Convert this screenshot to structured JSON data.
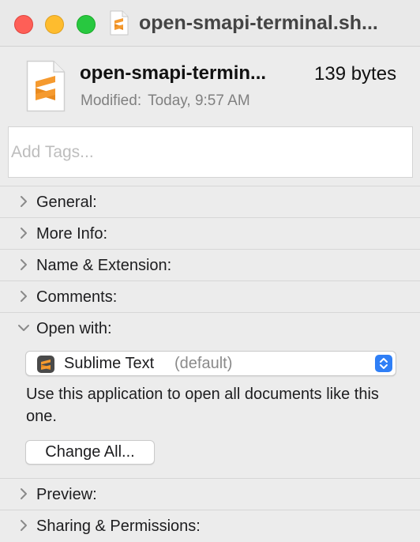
{
  "window": {
    "title": "open-smapi-terminal.sh..."
  },
  "file": {
    "name": "open-smapi-termin...",
    "size": "139 bytes",
    "modified_label": "Modified:",
    "modified_value": "Today, 9:57 AM",
    "icon": "sublime-file-icon"
  },
  "tags": {
    "placeholder": "Add Tags..."
  },
  "sections": {
    "general": "General:",
    "more_info": "More Info:",
    "name_extension": "Name & Extension:",
    "comments": "Comments:",
    "open_with": "Open with:",
    "preview": "Preview:",
    "sharing": "Sharing & Permissions:"
  },
  "open_with": {
    "app_name": "Sublime Text",
    "app_default": "(default)",
    "description": "Use this application to open all documents like this one.",
    "change_all_label": "Change All..."
  },
  "colors": {
    "accent": "#2f7ff6",
    "sublime_orange": "#f59a2f",
    "close": "#fe5f57",
    "minimize": "#febc2e",
    "maximize": "#28c840"
  }
}
